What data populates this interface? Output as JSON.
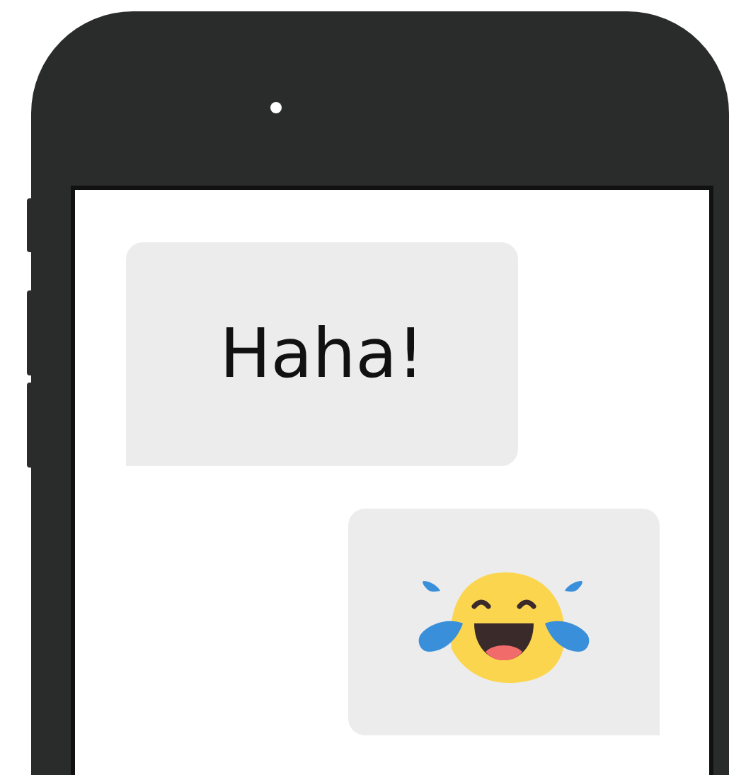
{
  "messages": [
    {
      "kind": "text",
      "outgoing": false,
      "text": "Haha!"
    },
    {
      "kind": "emoji",
      "outgoing": true
    }
  ]
}
